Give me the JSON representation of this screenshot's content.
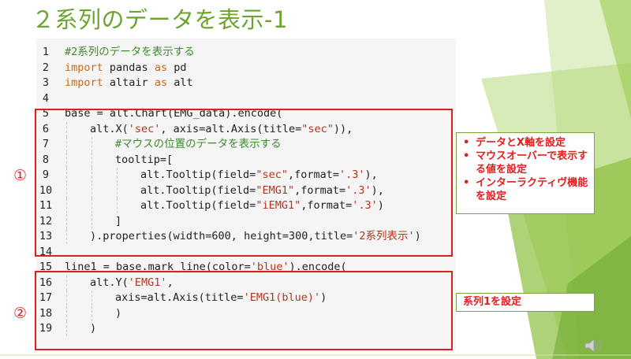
{
  "slide": {
    "title": "２系列のデータを表示-1"
  },
  "code_lines": [
    {
      "n": "1",
      "indent": 0,
      "parts": [
        {
          "t": "#2系列のデータを表示する",
          "c": "cm"
        }
      ]
    },
    {
      "n": "2",
      "indent": 0,
      "parts": [
        {
          "t": "import",
          "c": "kw"
        },
        {
          "t": " pandas ",
          "c": "nm"
        },
        {
          "t": "as",
          "c": "kw"
        },
        {
          "t": " pd",
          "c": "nm"
        }
      ]
    },
    {
      "n": "3",
      "indent": 0,
      "parts": [
        {
          "t": "import",
          "c": "kw"
        },
        {
          "t": " altair ",
          "c": "nm"
        },
        {
          "t": "as",
          "c": "kw"
        },
        {
          "t": " alt",
          "c": "nm"
        }
      ]
    },
    {
      "n": "4",
      "indent": 0,
      "parts": []
    },
    {
      "n": "5",
      "indent": 0,
      "parts": [
        {
          "t": "base = alt.Chart(EMG_data).encode(",
          "c": "nm"
        }
      ]
    },
    {
      "n": "6",
      "indent": 1,
      "parts": [
        {
          "t": "alt.X(",
          "c": "nm"
        },
        {
          "t": "'sec'",
          "c": "st"
        },
        {
          "t": ", axis=alt.Axis(title=",
          "c": "nm"
        },
        {
          "t": "\"sec\"",
          "c": "st"
        },
        {
          "t": ")),",
          "c": "nm"
        }
      ]
    },
    {
      "n": "7",
      "indent": 2,
      "parts": [
        {
          "t": "#マウスの位置のデータを表示する",
          "c": "cm"
        }
      ]
    },
    {
      "n": "8",
      "indent": 2,
      "parts": [
        {
          "t": "tooltip=[",
          "c": "nm"
        }
      ]
    },
    {
      "n": "9",
      "indent": 3,
      "parts": [
        {
          "t": "alt.Tooltip(field=",
          "c": "nm"
        },
        {
          "t": "\"sec\"",
          "c": "st"
        },
        {
          "t": ",format=",
          "c": "nm"
        },
        {
          "t": "'.3'",
          "c": "st"
        },
        {
          "t": "),",
          "c": "nm"
        }
      ]
    },
    {
      "n": "10",
      "indent": 3,
      "parts": [
        {
          "t": "alt.Tooltip(field=",
          "c": "nm"
        },
        {
          "t": "\"EMG1\"",
          "c": "st"
        },
        {
          "t": ",format=",
          "c": "nm"
        },
        {
          "t": "'.3'",
          "c": "st"
        },
        {
          "t": "),",
          "c": "nm"
        }
      ]
    },
    {
      "n": "11",
      "indent": 3,
      "parts": [
        {
          "t": "alt.Tooltip(field=",
          "c": "nm"
        },
        {
          "t": "\"iEMG1\"",
          "c": "st"
        },
        {
          "t": ",format=",
          "c": "nm"
        },
        {
          "t": "'.3'",
          "c": "st"
        },
        {
          "t": ")",
          "c": "nm"
        }
      ]
    },
    {
      "n": "12",
      "indent": 2,
      "parts": [
        {
          "t": "]",
          "c": "nm"
        }
      ]
    },
    {
      "n": "13",
      "indent": 1,
      "parts": [
        {
          "t": ").properties(width=600, height=300,title=",
          "c": "nm"
        },
        {
          "t": "'2系列表示'",
          "c": "st"
        },
        {
          "t": ")",
          "c": "nm"
        }
      ]
    },
    {
      "n": "14",
      "indent": 0,
      "parts": []
    },
    {
      "n": "15",
      "indent": 0,
      "parts": [
        {
          "t": "line1 = base.mark_line(color=",
          "c": "nm"
        },
        {
          "t": "'blue'",
          "c": "st"
        },
        {
          "t": ").encode(",
          "c": "nm"
        }
      ]
    },
    {
      "n": "16",
      "indent": 1,
      "parts": [
        {
          "t": "alt.Y(",
          "c": "nm"
        },
        {
          "t": "'EMG1'",
          "c": "st"
        },
        {
          "t": ",",
          "c": "nm"
        }
      ]
    },
    {
      "n": "17",
      "indent": 2,
      "parts": [
        {
          "t": "axis=alt.Axis(title=",
          "c": "nm"
        },
        {
          "t": "'EMG1(blue)'",
          "c": "st"
        },
        {
          "t": ")",
          "c": "nm"
        }
      ]
    },
    {
      "n": "18",
      "indent": 2,
      "parts": [
        {
          "t": ")",
          "c": "nm"
        }
      ]
    },
    {
      "n": "19",
      "indent": 1,
      "parts": [
        {
          "t": ")",
          "c": "nm"
        }
      ]
    }
  ],
  "markers": {
    "first": "①",
    "second": "②"
  },
  "callout1": {
    "items": [
      "データとX軸を設定",
      "マウスオーバーで表示する値を設定",
      "インターラクティヴ機能を設定"
    ]
  },
  "callout2": {
    "text": "系列1を設定"
  },
  "icons": {
    "speaker": "speaker-icon"
  },
  "colors": {
    "title": "#6ba52f",
    "accent_red": "#e02020",
    "deco_light": "#c9e39a",
    "deco_dark": "#8cbf3f"
  }
}
